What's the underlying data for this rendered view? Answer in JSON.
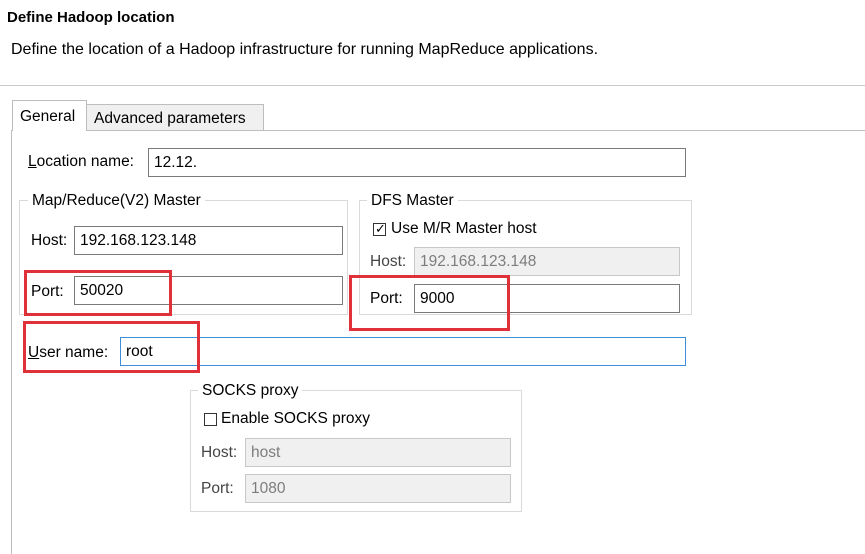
{
  "header": {
    "title": "Define Hadoop location",
    "description": "Define the location of a Hadoop infrastructure for running MapReduce applications."
  },
  "tabs": [
    {
      "label": "General",
      "selected": true
    },
    {
      "label": "Advanced parameters",
      "selected": false
    }
  ],
  "location": {
    "label_prefix": "L",
    "label_rest": "ocation name:",
    "value": "12.12."
  },
  "mr_master": {
    "title": "Map/Reduce(V2) Master",
    "host_label": "Host:",
    "host_value": "192.168.123.148",
    "port_label": "Port:",
    "port_value": "50020"
  },
  "dfs_master": {
    "title": "DFS Master",
    "use_mr_host_label": "Use M/R Master host",
    "use_mr_host_checked": true,
    "host_label": "Host:",
    "host_value": "192.168.123.148",
    "port_label": "Port:",
    "port_value": "9000"
  },
  "user": {
    "label_prefix": "U",
    "label_rest": "ser name:",
    "value": "root"
  },
  "socks_proxy": {
    "title": "SOCKS proxy",
    "enable_label": "Enable SOCKS proxy",
    "enable_checked": false,
    "host_label": "Host:",
    "host_value": "host",
    "port_label": "Port:",
    "port_value": "1080"
  },
  "colors": {
    "highlight": "#e0303a",
    "focus_border": "#3c8fd6"
  }
}
